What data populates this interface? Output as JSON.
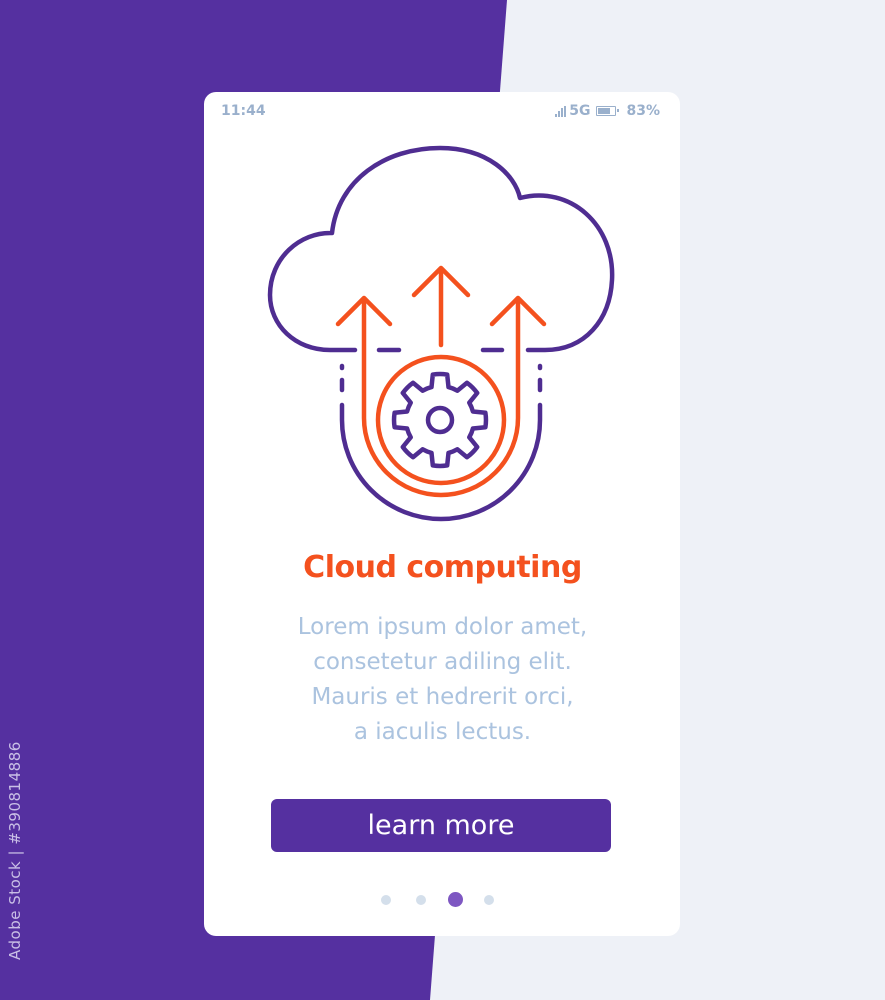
{
  "background": {
    "primary_color": "#5530a0",
    "secondary_color": "#eef1f7"
  },
  "watermark": {
    "text": "Adobe Stock | #390814886"
  },
  "status_bar": {
    "time": "11:44",
    "network": "5G",
    "battery_percent": "83%",
    "battery_level": 0.83,
    "icons": [
      "signal-icon",
      "battery-icon"
    ]
  },
  "illustration": {
    "icon": "cloud-computing-icon",
    "elements": [
      "cloud-icon",
      "upload-arrow-icon",
      "gear-icon"
    ],
    "colors": {
      "outline": "#4f2d91",
      "accent": "#f4511e"
    }
  },
  "onboarding": {
    "title": "Cloud computing",
    "body_lines": [
      "Lorem ipsum dolor amet,",
      "consetetur adiling elit.",
      "Mauris et hedrerit orci,",
      "a iaculis lectus."
    ],
    "cta_label": "learn more",
    "pagination": {
      "total": 4,
      "current": 3
    }
  }
}
